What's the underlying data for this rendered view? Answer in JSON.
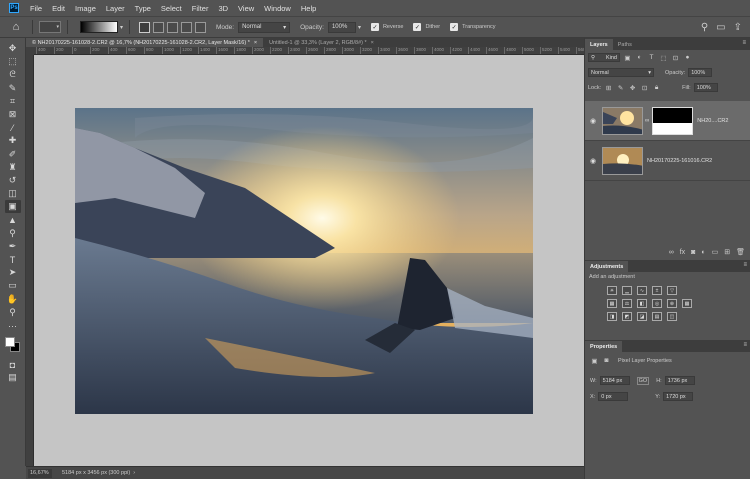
{
  "menubar": {
    "logo": "Ps",
    "items": [
      "File",
      "Edit",
      "Image",
      "Layer",
      "Type",
      "Select",
      "Filter",
      "3D",
      "View",
      "Window",
      "Help"
    ]
  },
  "options": {
    "mode_label": "Mode:",
    "mode_value": "Normal",
    "opacity_label": "Opacity:",
    "opacity_value": "100%",
    "reverse_label": "Reverse",
    "dither_label": "Dither",
    "transparency_label": "Transparency"
  },
  "tabs": [
    {
      "label": "© NH20170225-161028-2.CR2 @ 16,7% (NH20170225-161028-2.CR2, Layer Mask/16) *",
      "close": "×",
      "active": true
    },
    {
      "label": "Untitled-1 @ 33,3% (Layer 2, RGB/8#) *",
      "close": "×",
      "active": false
    }
  ],
  "ruler": {
    "ticks": [
      "400",
      "200",
      "0",
      "200",
      "400",
      "600",
      "800",
      "1000",
      "1200",
      "1400",
      "1600",
      "1800",
      "2000",
      "2200",
      "2400",
      "2600",
      "2800",
      "3000",
      "3200",
      "3400",
      "3600",
      "3800",
      "4000",
      "4200",
      "4400",
      "4600",
      "4800",
      "5000",
      "5200",
      "5400",
      "5600"
    ]
  },
  "toolbar": {
    "tools": [
      {
        "name": "move-tool",
        "glyph": "✥"
      },
      {
        "name": "marquee-tool",
        "glyph": "⬚"
      },
      {
        "name": "lasso-tool",
        "glyph": "ᘓ"
      },
      {
        "name": "quick-select-tool",
        "glyph": "✎"
      },
      {
        "name": "crop-tool",
        "glyph": "⌗"
      },
      {
        "name": "frame-tool",
        "glyph": "⊠"
      },
      {
        "name": "eyedropper-tool",
        "glyph": "⁄"
      },
      {
        "name": "healing-tool",
        "glyph": "✚"
      },
      {
        "name": "brush-tool",
        "glyph": "✐"
      },
      {
        "name": "clone-stamp-tool",
        "glyph": "♜"
      },
      {
        "name": "history-brush-tool",
        "glyph": "↺"
      },
      {
        "name": "eraser-tool",
        "glyph": "◫"
      },
      {
        "name": "gradient-tool",
        "glyph": "▣"
      },
      {
        "name": "blur-tool",
        "glyph": "▲"
      },
      {
        "name": "dodge-tool",
        "glyph": "⚲"
      },
      {
        "name": "pen-tool",
        "glyph": "✒"
      },
      {
        "name": "type-tool",
        "glyph": "T"
      },
      {
        "name": "path-select-tool",
        "glyph": "➤"
      },
      {
        "name": "shape-tool",
        "glyph": "▭"
      },
      {
        "name": "hand-tool",
        "glyph": "✋"
      },
      {
        "name": "zoom-tool",
        "glyph": "⚲"
      },
      {
        "name": "more-tools",
        "glyph": "···"
      }
    ]
  },
  "status": {
    "zoom": "16,67%",
    "doc_info": "5184 px x 3456 px (300 ppi)",
    "arrow": "›"
  },
  "layers_panel": {
    "tabs": [
      "Layers",
      "Paths"
    ],
    "kind_label": "Kind",
    "blend_mode": "Normal",
    "opacity_label": "Opacity:",
    "opacity_value": "100%",
    "lock_label": "Lock:",
    "fill_label": "Fill:",
    "fill_value": "100%",
    "layers": [
      {
        "name": "NH20....CR2",
        "has_mask": true,
        "selected": true
      },
      {
        "name": "NH20170225-161016.CR2",
        "has_mask": false,
        "selected": false
      }
    ]
  },
  "adjustments_panel": {
    "title": "Adjustments",
    "subtitle": "Add an adjustment"
  },
  "properties_panel": {
    "title": "Properties",
    "subtitle": "Pixel Layer Properties",
    "w_label": "W:",
    "w_value": "5184 px",
    "h_label": "H:",
    "h_value": "1736 px",
    "x_label": "X:",
    "x_value": "0 px",
    "y_label": "Y:",
    "y_value": "1720 px",
    "link": "GO"
  },
  "colors": {
    "ui_bg": "#535353",
    "canvas_bg": "#c5c5c5",
    "accent": "#31a8ff"
  }
}
